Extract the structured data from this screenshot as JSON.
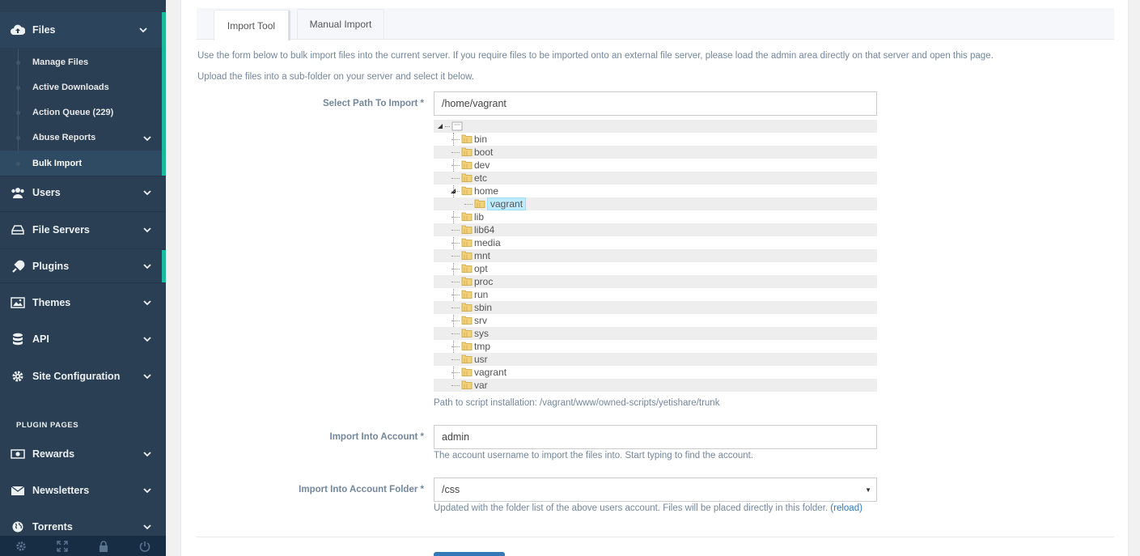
{
  "sidebar": {
    "files": "Files",
    "sub_items": [
      "Manage Files",
      "Active Downloads",
      "Action Queue (229)",
      "Abuse Reports",
      "Bulk Import"
    ],
    "users": "Users",
    "file_servers": "File Servers",
    "plugins": "Plugins",
    "themes": "Themes",
    "api": "API",
    "site_configuration": "Site Configuration",
    "plugin_pages_heading": "PLUGIN PAGES",
    "rewards": "Rewards",
    "newsletters": "Newsletters",
    "torrents": "Torrents",
    "footer_icons": [
      "gear-icon",
      "fullscreen-icon",
      "lock-icon",
      "power-icon"
    ]
  },
  "tabs": [
    "Import Tool",
    "Manual Import"
  ],
  "intro": {
    "line1": "Use the form below to bulk import files into the current server. If you require files to be imported onto an external file server, please load the admin area directly on that server and open this page.",
    "line2": "Upload the files into a sub-folder on your server and select it below."
  },
  "path_field": {
    "label": "Select Path To Import *",
    "value": "/home/vagrant",
    "tree": {
      "root_label": "",
      "items": [
        "bin",
        "boot",
        "dev",
        "etc",
        "home",
        "vagrant",
        "lib",
        "lib64",
        "media",
        "mnt",
        "opt",
        "proc",
        "run",
        "sbin",
        "srv",
        "sys",
        "tmp",
        "usr",
        "vagrant",
        "var"
      ],
      "selected": "vagrant"
    },
    "help": "Path to script installation: /vagrant/www/owned-scripts/yetishare/trunk"
  },
  "account_field": {
    "label": "Import Into Account *",
    "value": "admin",
    "help": "The account username to import the files into. Start typing to find the account."
  },
  "folder_field": {
    "label": "Import Into Account Folder *",
    "value": "/css",
    "help": "Updated with the folder list of the above users account. Files will be placed directly in this folder.",
    "reload_link": "(reload)"
  },
  "colors": {
    "sidebar_bg": "#2a3f54",
    "accent": "#1abb9c",
    "selected_node": "#beebff",
    "button": "#337ab7"
  }
}
